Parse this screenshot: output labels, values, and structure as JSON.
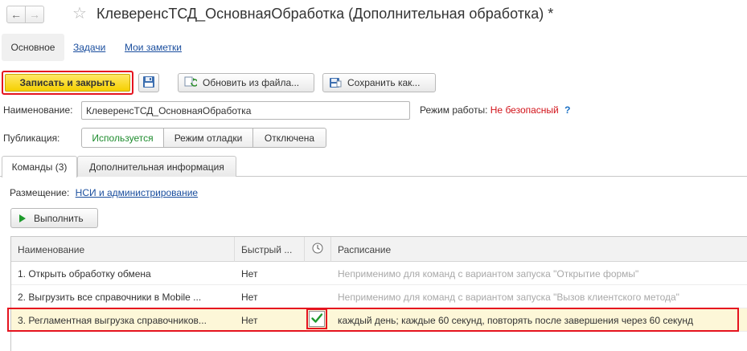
{
  "window": {
    "title": "КлеверенсТСД_ОсновнаяОбработка (Дополнительная обработка) *",
    "back_glyph": "←",
    "forward_glyph": "→",
    "star_glyph": "☆"
  },
  "top_tabs": {
    "main": "Основное",
    "tasks": "Задачи",
    "notes": "Мои заметки"
  },
  "toolbar": {
    "save_close_label": "Записать и закрыть",
    "update_from_file_label": "Обновить из файла...",
    "save_as_label": "Сохранить как..."
  },
  "form": {
    "name_label": "Наименование:",
    "name_value": "КлеверенсТСД_ОсновнаяОбработка",
    "mode_label": "Режим работы:",
    "mode_value": "Не безопасный",
    "mode_help": "?",
    "publication_label": "Публикация:",
    "publication_options": [
      "Используется",
      "Режим отладки",
      "Отключена"
    ],
    "publication_selected": "Используется"
  },
  "content_tabs": {
    "commands": "Команды (3)",
    "additional": "Дополнительная информация"
  },
  "placement": {
    "label": "Размещение:",
    "link": "НСИ и администрирование"
  },
  "run_button": {
    "label": "Выполнить"
  },
  "table": {
    "columns": {
      "name": "Наименование",
      "quick": "Быстрый ...",
      "schedule": "Расписание"
    },
    "rows": [
      {
        "name": "1. Открыть обработку обмена",
        "quick": "Нет",
        "scheduled": false,
        "schedule": "Неприменимо для команд с вариантом запуска \"Открытие формы\""
      },
      {
        "name": "2. Выгрузить все справочники в Mobile ...",
        "quick": "Нет",
        "scheduled": false,
        "schedule": "Неприменимо для команд с вариантом запуска \"Вызов клиентского метода\""
      },
      {
        "name": "3. Регламентная выгрузка справочников...",
        "quick": "Нет",
        "scheduled": true,
        "schedule": "каждый день; каждые 60 секунд, повторять после завершения через 60 секунд"
      }
    ]
  },
  "colors": {
    "accent_yellow": "#f5d000",
    "highlight_red": "#e5141f",
    "link_blue": "#1a4e9e",
    "active_green": "#1e8c2e",
    "warning_red": "#d2131a"
  }
}
